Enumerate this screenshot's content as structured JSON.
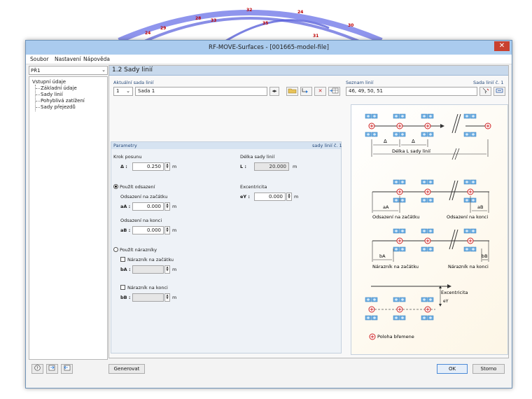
{
  "background": {
    "node_labels": [
      "24",
      "29",
      "28",
      "33",
      "32",
      "35",
      "24",
      "31",
      "30"
    ]
  },
  "window": {
    "title": "RF-MOVE-Surfaces - [001665-model-file]",
    "close_glyph": "✕"
  },
  "menu": [
    "Soubor",
    "Nastavení",
    "Nápověda"
  ],
  "nav": {
    "selected_case": "PŘ1",
    "tree": {
      "root": "Vstupní údaje",
      "items": [
        "Základní údaje",
        "Sady linií",
        "Pohyblivá zatížení",
        "Sady přejezdů"
      ]
    }
  },
  "header": {
    "title": "1.2 Sady linií"
  },
  "current_set": {
    "label": "Aktuální sada linií",
    "number": "1",
    "name": "Sada 1"
  },
  "line_list": {
    "label": "Seznam linií",
    "set_label": "Sada linií č. 1",
    "value": "46, 49, 50, 51"
  },
  "params": {
    "title": "Parametry",
    "set_label": "sady linií č. 1",
    "step_label": "Krok posunu",
    "step_symbol": "Δ :",
    "step_value": "0.250",
    "unit": "m",
    "length_label": "Délka sady linií",
    "length_symbol": "L :",
    "length_value": "20.000",
    "use_offset_label": "Použít odsazení",
    "offset_start_label": "Odsazení na začátku",
    "offset_start_symbol": "aA :",
    "offset_start_value": "0.000",
    "offset_end_label": "Odsazení na konci",
    "offset_end_symbol": "aB :",
    "offset_end_value": "0.000",
    "eccentricity_label": "Excentricita",
    "eccentricity_symbol": "eY :",
    "eccentricity_value": "0.000",
    "use_buffer_label": "Použít nárazníky",
    "buffer_start_label": "Nárazník na začátku",
    "buffer_start_symbol": "bA :",
    "buffer_end_label": "Nárazník na konci",
    "buffer_end_symbol": "bB :"
  },
  "diagram": {
    "delta": "Δ",
    "length": "Délka L sady linií",
    "aA": "aA",
    "aB": "aB",
    "offset_start": "Odsazení na začátku",
    "offset_end": "Odsazení na konci",
    "bA": "bA",
    "bB": "bB",
    "buffer_start": "Nárazník na začátku",
    "buffer_end": "Nárazník na konci",
    "eccentricity": "Excentricita",
    "ey": "eY",
    "load_position": "Poloha břemene"
  },
  "buttons": {
    "generate": "Generovat",
    "ok": "OK",
    "cancel": "Storno"
  },
  "colors": {
    "accent": "#aacbee",
    "header": "#c8d9ec",
    "marker": "#d02424",
    "plus_box": "#6fb0e4"
  }
}
